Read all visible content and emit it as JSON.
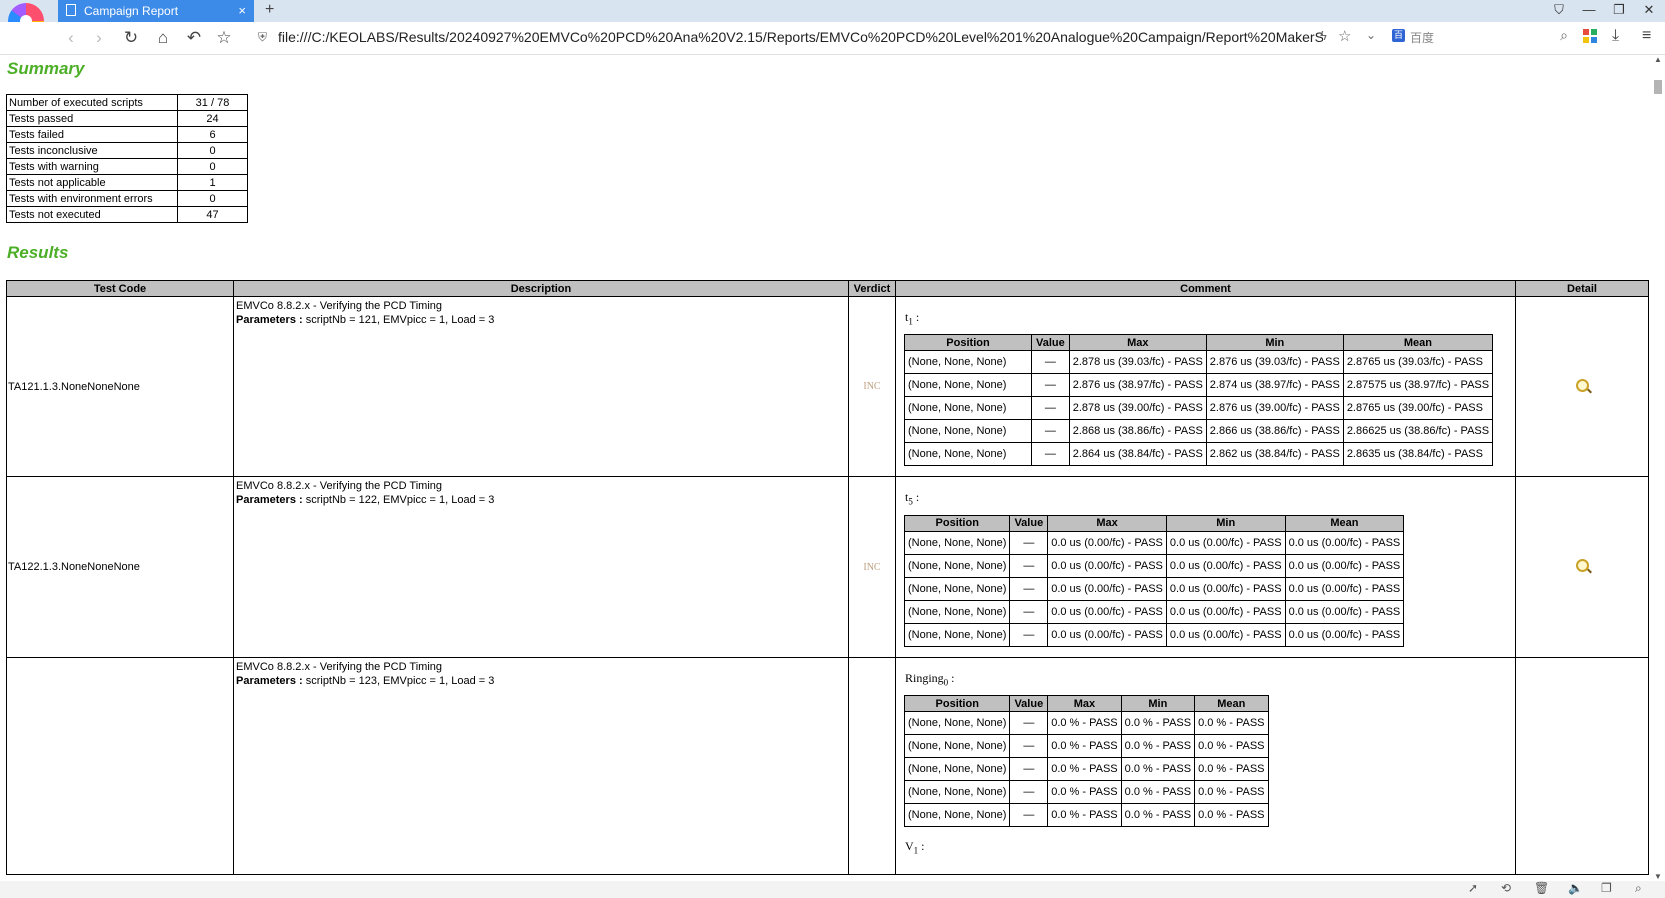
{
  "browser": {
    "tab_title": "Campaign Report",
    "tab_close": "×",
    "new_tab": "+",
    "url": "file:///C:/KEOLABS/Results/20240927%20EMVCo%20PCD%20Ana%20V2.15/Reports/EMVCo%20PCD%20Level%201%20Analogue%20Campaign/Report%20MakerS",
    "search_engine": "百度",
    "search_engine_icon": "百",
    "accent_color": "#3d8be9"
  },
  "summary": {
    "title": "Summary",
    "rows": [
      {
        "label": "Number of executed scripts",
        "value": "31 / 78"
      },
      {
        "label": "Tests passed",
        "value": "24"
      },
      {
        "label": "Tests failed",
        "value": "6"
      },
      {
        "label": "Tests inconclusive",
        "value": "0"
      },
      {
        "label": "Tests with warning",
        "value": "0"
      },
      {
        "label": "Tests not applicable",
        "value": "1"
      },
      {
        "label": "Tests with environment errors",
        "value": "0"
      },
      {
        "label": "Tests not executed",
        "value": "47"
      }
    ]
  },
  "results": {
    "title": "Results",
    "headers": {
      "code": "Test Code",
      "description": "Description",
      "verdict": "Verdict",
      "comment": "Comment",
      "detail": "Detail"
    },
    "sub_headers": {
      "position": "Position",
      "value": "Value",
      "max": "Max",
      "min": "Min",
      "mean": "Mean"
    },
    "params_label": "Parameters :",
    "rows": [
      {
        "code": "TA121.1.3.NoneNoneNone",
        "desc_line": "EMVCo 8.8.2.x - Verifying the PCD Timing",
        "params": " scriptNb = 121, EMVpicc = 1, Load = 3",
        "verdict": "INC",
        "label_main": "t",
        "label_sub": "1",
        "label_suffix": " :",
        "entries": [
          {
            "position": "(None, None, None)",
            "value": "—",
            "max": "2.878 us (39.03/fc) - PASS",
            "min": "2.876 us (39.03/fc) - PASS",
            "mean": "2.8765 us (39.03/fc) - PASS"
          },
          {
            "position": "(None, None, None)",
            "value": "—",
            "max": "2.876 us (38.97/fc) - PASS",
            "min": "2.874 us (38.97/fc) - PASS",
            "mean": "2.87575 us (38.97/fc) - PASS"
          },
          {
            "position": "(None, None, None)",
            "value": "—",
            "max": "2.878 us (39.00/fc) - PASS",
            "min": "2.876 us (39.00/fc) - PASS",
            "mean": "2.8765 us (39.00/fc) - PASS"
          },
          {
            "position": "(None, None, None)",
            "value": "—",
            "max": "2.868 us (38.86/fc) - PASS",
            "min": "2.866 us (38.86/fc) - PASS",
            "mean": "2.86625 us (38.86/fc) - PASS"
          },
          {
            "position": "(None, None, None)",
            "value": "—",
            "max": "2.864 us (38.84/fc) - PASS",
            "min": "2.862 us (38.84/fc) - PASS",
            "mean": "2.8635 us (38.84/fc) - PASS"
          }
        ]
      },
      {
        "code": "TA122.1.3.NoneNoneNone",
        "desc_line": "EMVCo 8.8.2.x - Verifying the PCD Timing",
        "params": " scriptNb = 122, EMVpicc = 1, Load = 3",
        "verdict": "INC",
        "label_main": "t",
        "label_sub": "5",
        "label_suffix": " :",
        "entries": [
          {
            "position": "(None, None, None)",
            "value": "—",
            "max": "0.0 us (0.00/fc) - PASS",
            "min": "0.0 us (0.00/fc) - PASS",
            "mean": "0.0 us (0.00/fc) - PASS"
          },
          {
            "position": "(None, None, None)",
            "value": "—",
            "max": "0.0 us (0.00/fc) - PASS",
            "min": "0.0 us (0.00/fc) - PASS",
            "mean": "0.0 us (0.00/fc) - PASS"
          },
          {
            "position": "(None, None, None)",
            "value": "—",
            "max": "0.0 us (0.00/fc) - PASS",
            "min": "0.0 us (0.00/fc) - PASS",
            "mean": "0.0 us (0.00/fc) - PASS"
          },
          {
            "position": "(None, None, None)",
            "value": "—",
            "max": "0.0 us (0.00/fc) - PASS",
            "min": "0.0 us (0.00/fc) - PASS",
            "mean": "0.0 us (0.00/fc) - PASS"
          },
          {
            "position": "(None, None, None)",
            "value": "—",
            "max": "0.0 us (0.00/fc) - PASS",
            "min": "0.0 us (0.00/fc) - PASS",
            "mean": "0.0 us (0.00/fc) - PASS"
          }
        ]
      },
      {
        "code": "",
        "desc_line": "EMVCo 8.8.2.x - Verifying the PCD Timing",
        "params": " scriptNb = 123, EMVpicc = 1, Load = 3",
        "verdict": "",
        "label_main": "Ringing",
        "label_sub": "0",
        "label_suffix": " :",
        "entries": [
          {
            "position": "(None, None, None)",
            "value": "—",
            "max": "0.0 % - PASS",
            "min": "0.0 % - PASS",
            "mean": "0.0 % - PASS"
          },
          {
            "position": "(None, None, None)",
            "value": "—",
            "max": "0.0 % - PASS",
            "min": "0.0 % - PASS",
            "mean": "0.0 % - PASS"
          },
          {
            "position": "(None, None, None)",
            "value": "—",
            "max": "0.0 % - PASS",
            "min": "0.0 % - PASS",
            "mean": "0.0 % - PASS"
          },
          {
            "position": "(None, None, None)",
            "value": "—",
            "max": "0.0 % - PASS",
            "min": "0.0 % - PASS",
            "mean": "0.0 % - PASS"
          },
          {
            "position": "(None, None, None)",
            "value": "—",
            "max": "0.0 % - PASS",
            "min": "0.0 % - PASS",
            "mean": "0.0 % - PASS"
          }
        ],
        "next_label_main": "V",
        "next_label_sub": "1",
        "next_label_suffix": " :"
      }
    ]
  },
  "icons": {
    "detail": "magnifier-icon"
  },
  "colors": {
    "heading": "#4caf27",
    "table_header": "#c0c0c0",
    "verdict_inc": "#c0a080"
  }
}
